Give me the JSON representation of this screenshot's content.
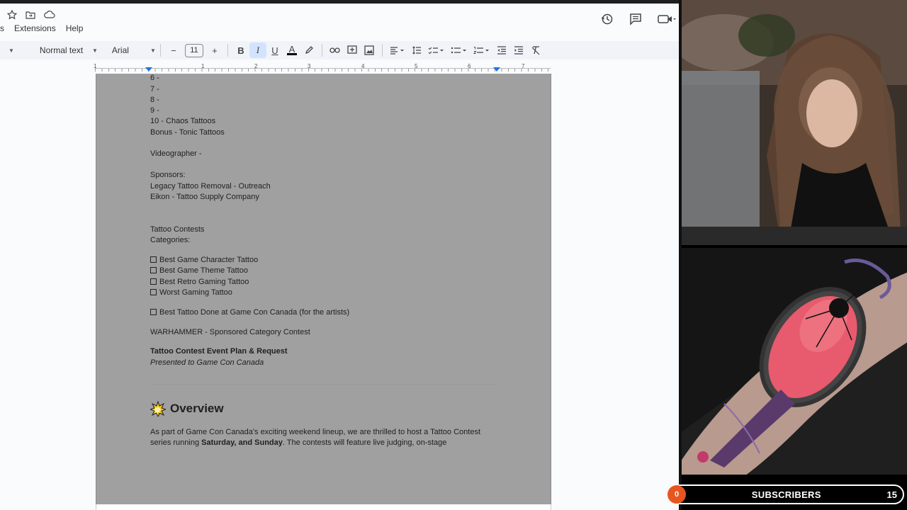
{
  "menu": {
    "items": [
      "s",
      "Extensions",
      "Help"
    ]
  },
  "toolbar": {
    "style_label": "Normal text",
    "font_label": "Arial",
    "font_size": "11",
    "minus": "−",
    "plus": "+",
    "bold": "B",
    "italic": "I",
    "underline": "U",
    "textcolor": "A"
  },
  "ruler": {
    "marks": [
      "1",
      "1",
      "2",
      "3",
      "4",
      "5",
      "6",
      "7"
    ]
  },
  "doc": {
    "lines": [
      "6 -",
      "7 -",
      "8 -",
      "9 -",
      "10 - Chaos Tattoos",
      "Bonus - Tonic Tattoos",
      "Videographer -",
      "Sponsors:",
      "Legacy Tattoo Removal - Outreach",
      "Eikon - Tattoo Supply Company",
      "Tattoo Contests",
      "Categories:"
    ],
    "checklist": [
      "Best Game Character Tattoo",
      "Best Game Theme Tattoo",
      "Best Retro Gaming Tattoo",
      "Worst Gaming Tattoo"
    ],
    "artist_item": "Best Tattoo Done at Game Con Canada (for the artists)",
    "warhammer": "WARHAMMER - Sponsored Category Contest",
    "plan_title": "Tattoo Contest Event Plan & Request",
    "plan_subtitle": "Presented to Game Con Canada",
    "overview_heading": "Overview",
    "para_line1": "As part of Game Con Canada's exciting weekend lineup, we are thrilled to host a Tattoo Contest",
    "para_line2_pre": "series running ",
    "para_line2_bold": "Saturday, and Sunday",
    "para_line2_post": ". The contests will feature live judging, on-stage"
  },
  "subscribers": {
    "badge": "0",
    "label": "SUBSCRIBERS",
    "count": "15"
  }
}
